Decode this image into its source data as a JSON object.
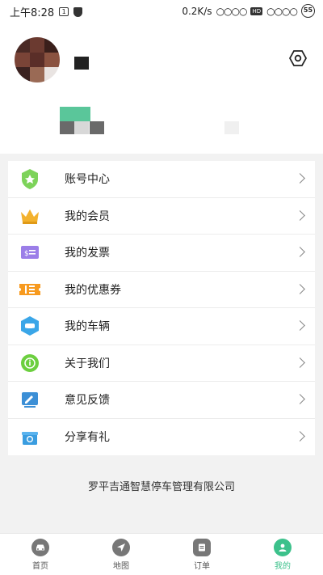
{
  "status_bar": {
    "time": "上午8:28",
    "box_label": "1",
    "speed": "0.2K/s",
    "hd": "HD",
    "battery": "55"
  },
  "profile": {
    "settings_icon": "settings-hexagon-icon"
  },
  "menu": {
    "items": [
      {
        "label": "账号中心",
        "icon": "account-center-icon"
      },
      {
        "label": "我的会员",
        "icon": "crown-icon"
      },
      {
        "label": "我的发票",
        "icon": "invoice-icon"
      },
      {
        "label": "我的优惠券",
        "icon": "coupon-icon"
      },
      {
        "label": "我的车辆",
        "icon": "car-icon"
      },
      {
        "label": "关于我们",
        "icon": "info-icon"
      },
      {
        "label": "意见反馈",
        "icon": "feedback-icon"
      },
      {
        "label": "分享有礼",
        "icon": "gift-icon"
      }
    ]
  },
  "company_name": "罗平吉通智慧停车管理有限公司",
  "tabbar": {
    "tabs": [
      {
        "label": "首页",
        "icon": "car-home-icon",
        "active": false
      },
      {
        "label": "地图",
        "icon": "navigation-icon",
        "active": false
      },
      {
        "label": "订单",
        "icon": "order-icon",
        "active": false
      },
      {
        "label": "我的",
        "icon": "user-icon",
        "active": true
      }
    ]
  },
  "colors": {
    "accent": "#3cc18b",
    "background": "#f2f2f2"
  }
}
